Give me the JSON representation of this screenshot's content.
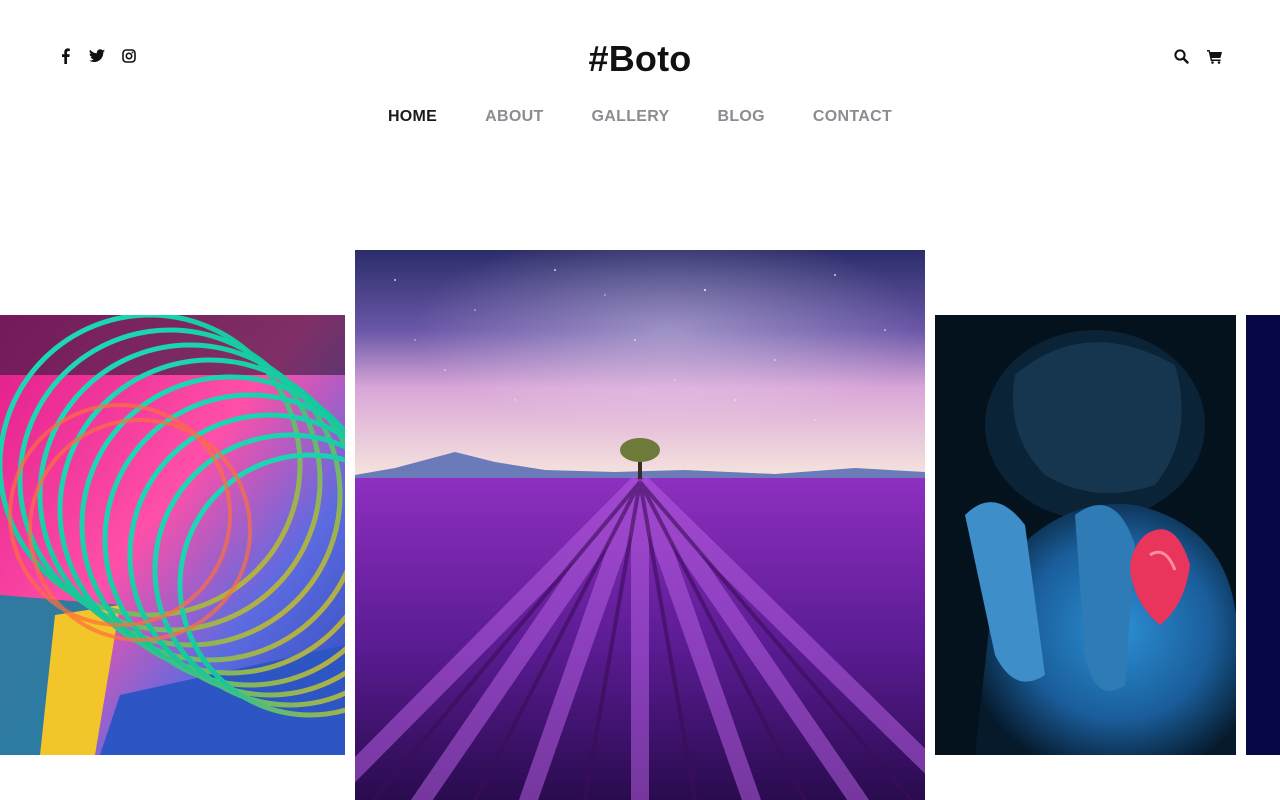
{
  "brand": {
    "title": "#Boto"
  },
  "social": {
    "icons": [
      "facebook-icon",
      "twitter-icon",
      "instagram-icon"
    ]
  },
  "tools": {
    "icons": [
      "search-icon",
      "cart-icon"
    ]
  },
  "nav": {
    "items": [
      {
        "label": "HOME",
        "active": true
      },
      {
        "label": "ABOUT",
        "active": false
      },
      {
        "label": "GALLERY",
        "active": false
      },
      {
        "label": "BLOG",
        "active": false
      },
      {
        "label": "CONTACT",
        "active": false
      }
    ],
    "active_underline_color": "#7db33a"
  },
  "gallery": {
    "images": [
      {
        "name": "rainbow-slinky-photo"
      },
      {
        "name": "lavender-field-milky-way-photo"
      },
      {
        "name": "blue-painted-man-heart-photo"
      },
      {
        "name": "dark-blue-partial-photo"
      }
    ]
  },
  "colors": {
    "text": "#111111",
    "nav_inactive": "#8a8d92",
    "accent": "#7db33a"
  }
}
